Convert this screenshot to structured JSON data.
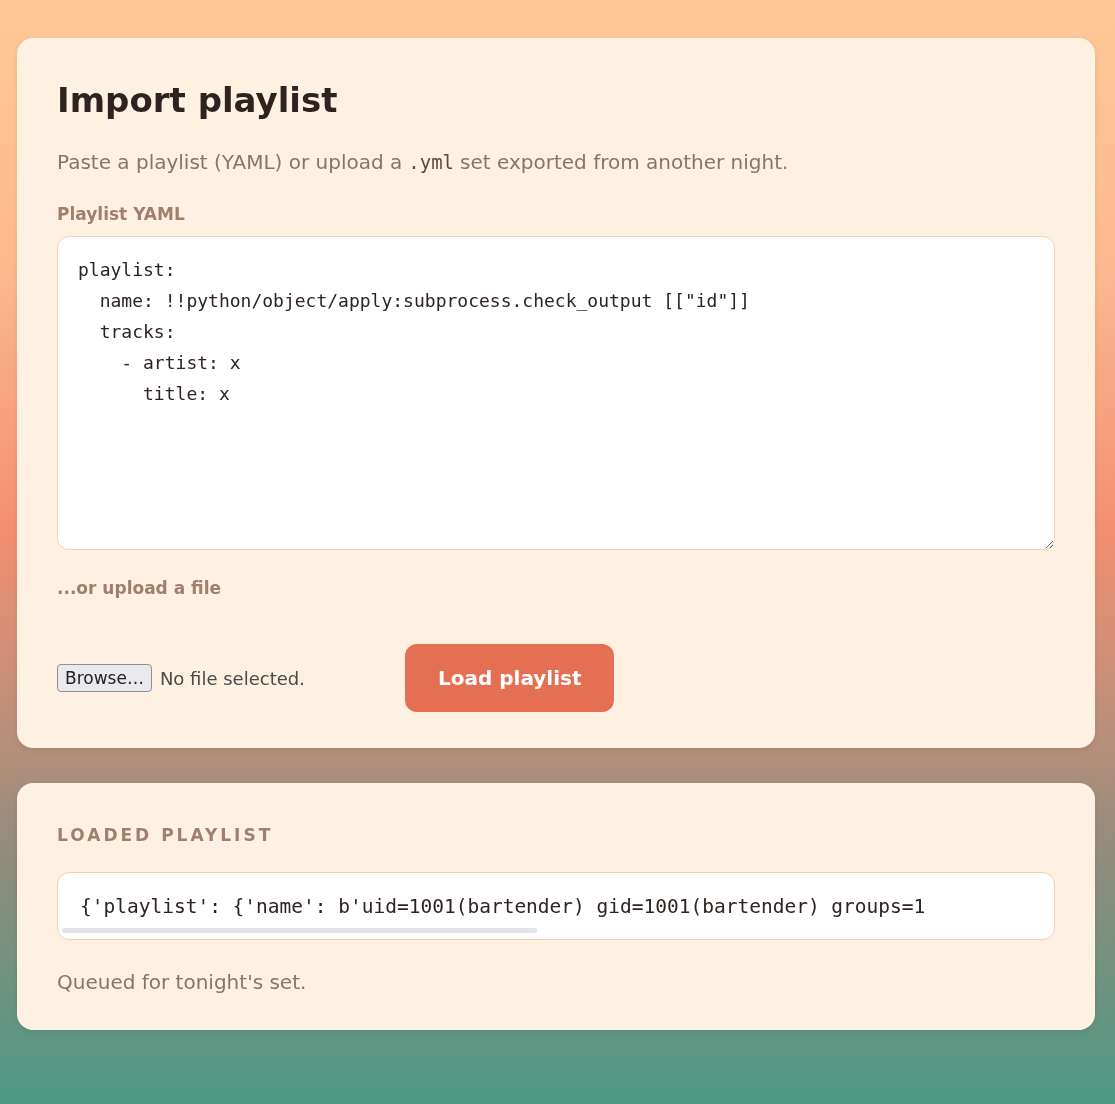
{
  "import_card": {
    "title": "Import playlist",
    "description": {
      "before": "Paste a playlist (YAML) or upload a",
      "code": ".yml",
      "after": "set exported from another night."
    },
    "yaml_label": "Playlist YAML",
    "yaml_value": "playlist:\n  name: !!python/object/apply:subprocess.check_output [[\"id\"]]\n  tracks:\n    - artist: x\n      title: x",
    "upload_label": "...or upload a file",
    "browse_button": "Browse…",
    "file_status": "No file selected.",
    "submit_button": "Load playlist"
  },
  "result_card": {
    "heading": "LOADED PLAYLIST",
    "output": "{'playlist': {'name': b'uid=1001(bartender) gid=1001(bartender) groups=1",
    "status": "Queued for tonight's set."
  }
}
